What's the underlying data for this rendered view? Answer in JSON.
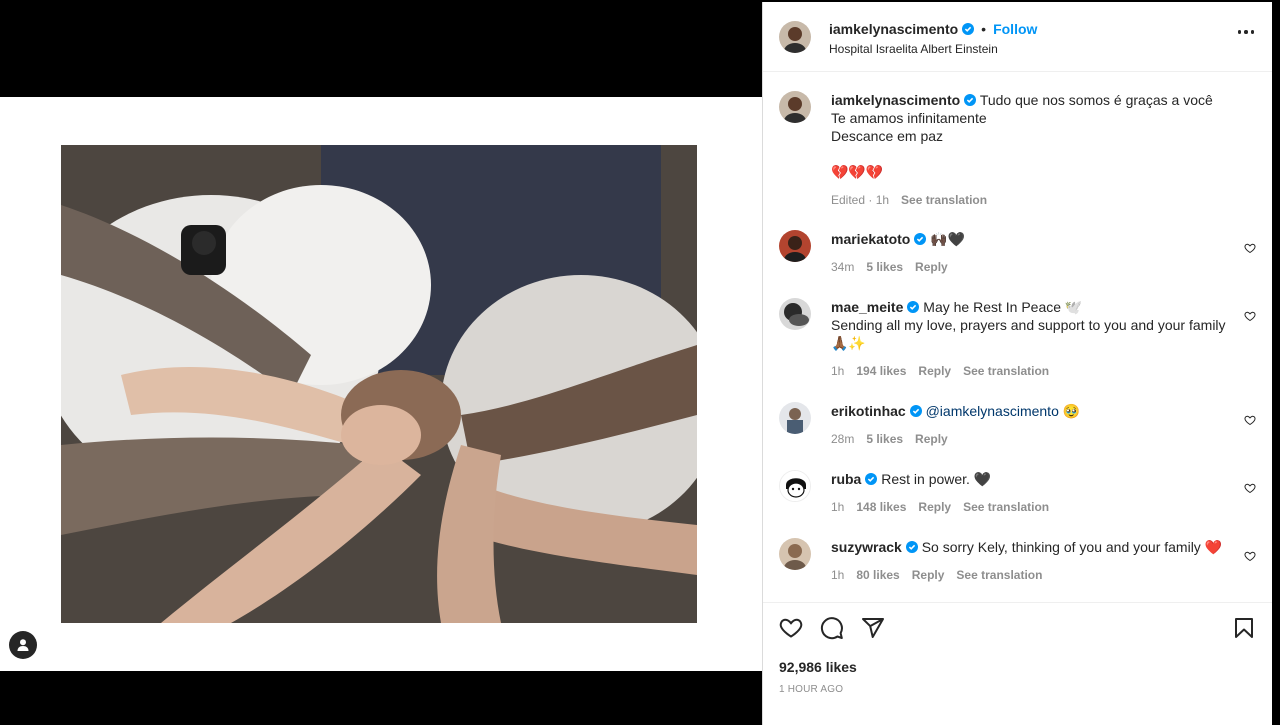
{
  "post": {
    "username": "iamkelynascimento",
    "location": "Hospital Israelita Albert Einstein",
    "follow_label": "Follow",
    "dot": "•",
    "caption_lines": [
      "Tudo que nos somos é graças a você",
      "Te amamos infinitamente",
      "Descance em paz"
    ],
    "caption_emoji": "💔💔💔",
    "caption_meta": {
      "edited": "Edited · 1h",
      "translate": "See translation"
    }
  },
  "comments": [
    {
      "username": "mariekatoto",
      "text": "🙌🏿🖤",
      "time": "34m",
      "likes": "5 likes",
      "reply": "Reply",
      "translate": "",
      "avatar_color": "#8a3b2e"
    },
    {
      "username": "mae_meite",
      "text": "May he Rest In Peace 🕊️",
      "text2": "Sending all my love, prayers and support to you and your family 🙏🏾✨",
      "time": "1h",
      "likes": "194 likes",
      "reply": "Reply",
      "translate": "See translation",
      "avatar_color": "#3a3a3a"
    },
    {
      "username": "erikotinhac",
      "text": "",
      "mention": "@iamkelynascimento",
      "emoji": "🥹",
      "time": "28m",
      "likes": "5 likes",
      "reply": "Reply",
      "translate": "",
      "avatar_color": "#6f7e8f"
    },
    {
      "username": "ruba",
      "text": "Rest in power. 🖤",
      "time": "1h",
      "likes": "148 likes",
      "reply": "Reply",
      "translate": "See translation",
      "avatar_color": "#ffffff"
    },
    {
      "username": "suzywrack",
      "text": "So sorry Kely, thinking of you and your family ❤️",
      "time": "1h",
      "likes": "80 likes",
      "reply": "Reply",
      "translate": "See translation",
      "avatar_color": "#b08b6e"
    }
  ],
  "footer": {
    "likes": "92,986 likes",
    "time": "1 HOUR AGO"
  },
  "colors": {
    "accent": "#0095f6",
    "verified": "#0095f6",
    "text": "#262626",
    "muted": "#8e8e8e"
  }
}
